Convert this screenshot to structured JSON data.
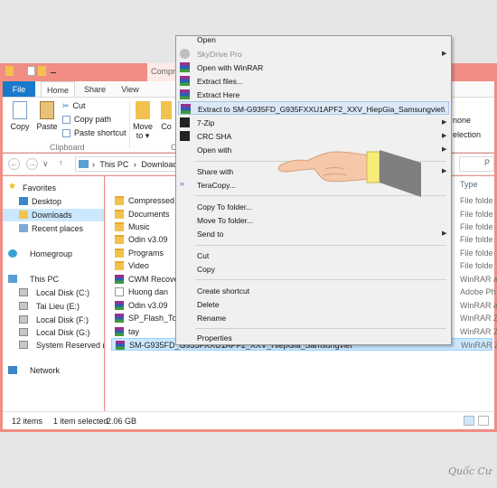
{
  "quick_access": {
    "context_tab_label": "Compre"
  },
  "ribbon": {
    "tabs": [
      "File",
      "Home",
      "Share",
      "View"
    ],
    "copy_label": "Copy",
    "paste_label": "Paste",
    "cut_label": "Cut",
    "copy_path_label": "Copy path",
    "paste_shortcut_label": "Paste shortcut",
    "clipboard_group": "Clipboard",
    "move_to_label": "Move to ▾",
    "copy_to_label": "Co",
    "organize_group_fragment": "O",
    "right_none": "none",
    "right_selection": "election"
  },
  "address": {
    "back": "←",
    "forward": "→",
    "dropdown": "∨",
    "up": "↑",
    "path": [
      "This PC",
      "Downloads"
    ],
    "separator": "›",
    "search_fragment": "P"
  },
  "nav": {
    "items": [
      {
        "label": "Favorites"
      },
      {
        "label": "Desktop"
      },
      {
        "label": "Downloads"
      },
      {
        "label": "Recent places"
      },
      {
        "label": "Homegroup"
      },
      {
        "label": "This PC"
      },
      {
        "label": "Local Disk (C:)"
      },
      {
        "label": "Tai Lieu (E:)"
      },
      {
        "label": "Local Disk (F:)"
      },
      {
        "label": "Local Disk (G:)"
      },
      {
        "label": "System Reserved (H:"
      },
      {
        "label": "Network"
      }
    ]
  },
  "files": {
    "name_header": "Name",
    "type_header": "Type",
    "rows": [
      {
        "name": "Compressed",
        "type": "File folde",
        "icon": "folder"
      },
      {
        "name": "Documents",
        "type": "File folde",
        "icon": "folder"
      },
      {
        "name": "Music",
        "type": "File folde",
        "icon": "folder"
      },
      {
        "name": "Odin v3.09",
        "type": "File folde",
        "icon": "folder"
      },
      {
        "name": "Programs",
        "type": "File folde",
        "icon": "folder"
      },
      {
        "name": "Video",
        "type": "File folde",
        "icon": "folder"
      },
      {
        "name": "CWM Recovery",
        "type": "WinRAR a",
        "icon": "rar"
      },
      {
        "name": "Huong dan",
        "type": "Adobe Ph",
        "icon": "doc"
      },
      {
        "name": "Odin v3.09",
        "type": "WinRAR a",
        "icon": "rar"
      },
      {
        "name": "SP_Flash_Tool_",
        "type": "WinRAR Z",
        "icon": "rar"
      },
      {
        "name": "tay",
        "type": "WinRAR Z",
        "icon": "rar"
      },
      {
        "name": "SM-G935FD_G935FXXU1APF2_XXV_HiepGia_Samsungviet",
        "type": "WinRAR Z",
        "icon": "rar"
      }
    ]
  },
  "status": {
    "items_count": "12 items",
    "selected": "1 item selected",
    "size": "2.06 GB"
  },
  "context_menu": {
    "items": [
      {
        "label": "Open",
        "icon": "none"
      },
      {
        "label": "SkyDrive Pro",
        "icon": "cloud",
        "disabled": true,
        "submenu": true
      },
      {
        "label": "Open with WinRAR",
        "icon": "rar"
      },
      {
        "label": "Extract files...",
        "icon": "rar"
      },
      {
        "label": "Extract Here",
        "icon": "rar"
      },
      {
        "label": "Extract to SM-G935FD_G935FXXU1APF2_XXV_HiepGia_Samsungviet\\",
        "icon": "rar",
        "highlighted": true
      },
      {
        "label": "7-Zip",
        "icon": "7zip",
        "submenu": true
      },
      {
        "label": "CRC SHA",
        "icon": "7zip",
        "submenu": true
      },
      {
        "label": "Open with",
        "icon": "none",
        "submenu": true
      },
      {
        "label": "Share with",
        "icon": "none",
        "submenu": true
      },
      {
        "label": "TeraCopy...",
        "icon": "teracopy"
      },
      {
        "label": "Copy To folder...",
        "icon": "none"
      },
      {
        "label": "Move To folder...",
        "icon": "none"
      },
      {
        "label": "Send to",
        "icon": "none",
        "submenu": true
      },
      {
        "label": "Cut",
        "icon": "none"
      },
      {
        "label": "Copy",
        "icon": "none"
      },
      {
        "label": "Create shortcut",
        "icon": "none"
      },
      {
        "label": "Delete",
        "icon": "none"
      },
      {
        "label": "Rename",
        "icon": "none"
      },
      {
        "label": "Properties",
        "icon": "none"
      }
    ],
    "submenu_arrow": "▶"
  },
  "watermark": "Quốc Cư",
  "colors": {
    "window_frame": "#f08e84",
    "file_tab": "#1979ca",
    "selection": "#cce8ff",
    "menu_highlight": "#dde8f7",
    "hand_cuff": "#f7ec7a",
    "hand_sleeve": "#7f7f7f"
  }
}
